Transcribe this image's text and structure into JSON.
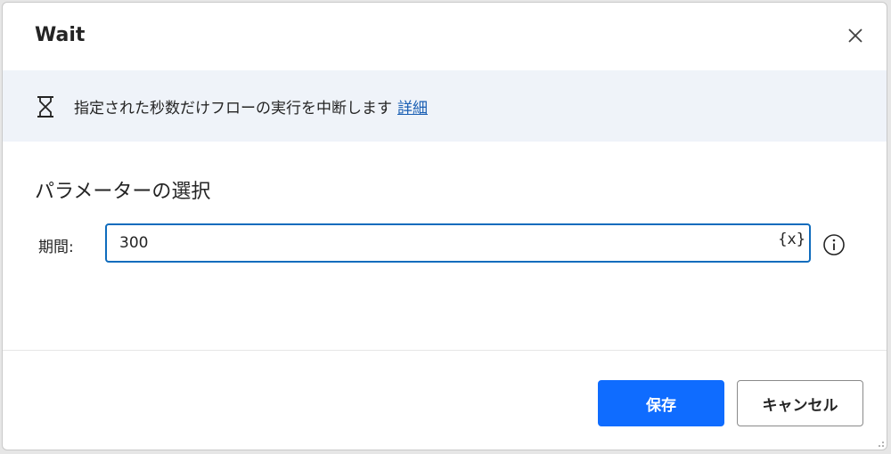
{
  "dialog": {
    "title": "Wait",
    "close_icon": "close-icon"
  },
  "info": {
    "icon": "hourglass-icon",
    "text": "指定された秒数だけフローの実行を中断します",
    "link_label": "詳細"
  },
  "parameters": {
    "section_title": "パラメーターの選択",
    "duration_label": "期間:",
    "duration_value": "300",
    "variable_button_label": "{x}",
    "info_icon": "info-circle-icon"
  },
  "footer": {
    "save_label": "保存",
    "cancel_label": "キャンセル"
  },
  "colors": {
    "accent": "#0f6cff",
    "input_border": "#0f6cbd",
    "info_bar_bg": "#eff3f9",
    "link": "#1a5fb4"
  }
}
